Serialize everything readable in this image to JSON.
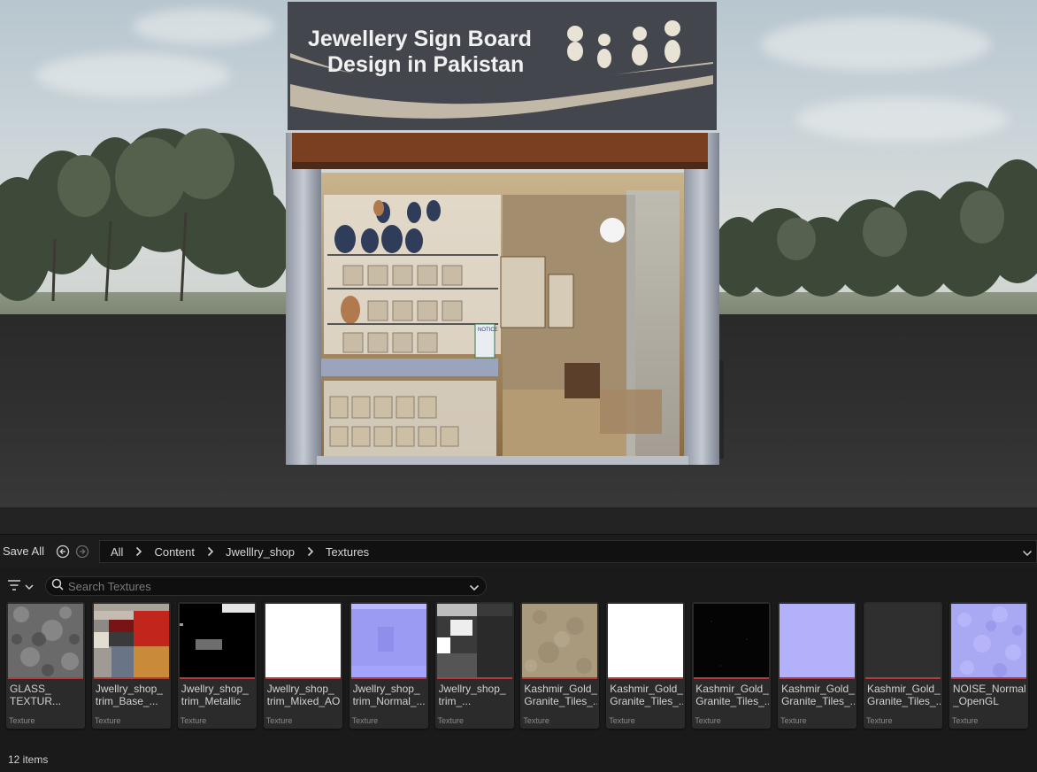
{
  "viewport": {
    "sign_line1": "Jewellery Sign Board",
    "sign_line2": "Design in Pakistan",
    "notice_label": "NOTICE"
  },
  "toolbar": {
    "save_all_label": "Save All",
    "back_icon": "back-arrow-icon",
    "forward_icon": "forward-arrow-icon"
  },
  "breadcrumb": [
    "All",
    "Content",
    "Jwelllry_shop",
    "Textures"
  ],
  "search": {
    "placeholder": "Search Textures",
    "value": ""
  },
  "assets": [
    {
      "name": "GLASS_\nTEXTUR...",
      "type": "Texture",
      "thumb": "glass"
    },
    {
      "name": "Jwellry_shop_\ntrim_Base_...",
      "type": "Texture",
      "thumb": "base"
    },
    {
      "name": "Jwellry_shop_\ntrim_Metallic",
      "type": "Texture",
      "thumb": "metallic"
    },
    {
      "name": "Jwellry_shop_\ntrim_Mixed_AO",
      "type": "Texture",
      "thumb": "white"
    },
    {
      "name": "Jwellry_shop_\ntrim_Normal_...",
      "type": "Texture",
      "thumb": "normal"
    },
    {
      "name": "Jwellry_shop_\ntrim_...",
      "type": "Texture",
      "thumb": "rough"
    },
    {
      "name": "Kashmir_Gold_\nGranite_Tiles_...",
      "type": "Texture",
      "thumb": "granite"
    },
    {
      "name": "Kashmir_Gold_\nGranite_Tiles_...",
      "type": "Texture",
      "thumb": "white"
    },
    {
      "name": "Kashmir_Gold_\nGranite_Tiles_...",
      "type": "Texture",
      "thumb": "black"
    },
    {
      "name": "Kashmir_Gold_\nGranite_Tiles_...",
      "type": "Texture",
      "thumb": "flatnormal"
    },
    {
      "name": "Kashmir_Gold_\nGranite_Tiles_...",
      "type": "Texture",
      "thumb": "darkgray"
    },
    {
      "name": "NOISE_Normal\n_OpenGL",
      "type": "Texture",
      "thumb": "noisenormal"
    }
  ],
  "status": {
    "item_count": "12 items"
  },
  "colors": {
    "asset_underline": "#b33b3b",
    "panel_bg": "#1a1a1a",
    "tile_bg": "#2b2b2b"
  }
}
